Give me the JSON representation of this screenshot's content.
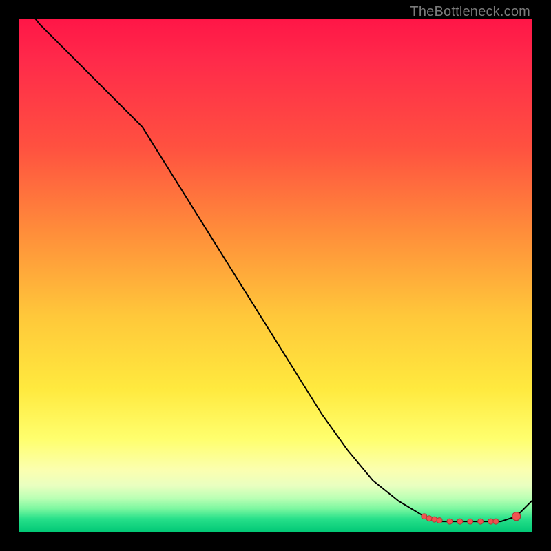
{
  "watermark": "TheBottleneck.com",
  "colors": {
    "frame": "#000000",
    "curve": "#000000",
    "marker_fill": "#ef5350",
    "marker_stroke": "#b13a38",
    "gradient_top": "#ff1647",
    "gradient_bottom": "#02c876"
  },
  "chart_data": {
    "type": "line",
    "title": "",
    "xlabel": "",
    "ylabel": "",
    "xlim": [
      0,
      100
    ],
    "ylim": [
      0,
      100
    ],
    "grid": false,
    "note": "No axis ticks or numeric labels are rendered in the image; values below are estimated from pixel positions on a 0–100 normalized scale (x left→right, y bottom→top).",
    "series": [
      {
        "name": "curve",
        "x": [
          0,
          4,
          9,
          14,
          19,
          24,
          29,
          34,
          39,
          44,
          49,
          54,
          59,
          64,
          69,
          74,
          79,
          82,
          85,
          88,
          91,
          94,
          97,
          100
        ],
        "y": [
          104,
          99,
          94,
          89,
          84,
          79,
          71,
          63,
          55,
          47,
          39,
          31,
          23,
          16,
          10,
          6,
          3,
          2,
          2,
          2,
          2,
          2,
          3,
          6
        ]
      }
    ],
    "markers": {
      "name": "highlight-points",
      "points": [
        {
          "x": 79,
          "y": 3
        },
        {
          "x": 80,
          "y": 2.6
        },
        {
          "x": 81,
          "y": 2.4
        },
        {
          "x": 82,
          "y": 2.2
        },
        {
          "x": 84,
          "y": 2.0
        },
        {
          "x": 86,
          "y": 2.0
        },
        {
          "x": 88,
          "y": 2.0
        },
        {
          "x": 90,
          "y": 2.0
        },
        {
          "x": 92,
          "y": 2.0
        },
        {
          "x": 93,
          "y": 2.0
        },
        {
          "x": 97,
          "y": 3.0,
          "big": true
        }
      ]
    }
  }
}
